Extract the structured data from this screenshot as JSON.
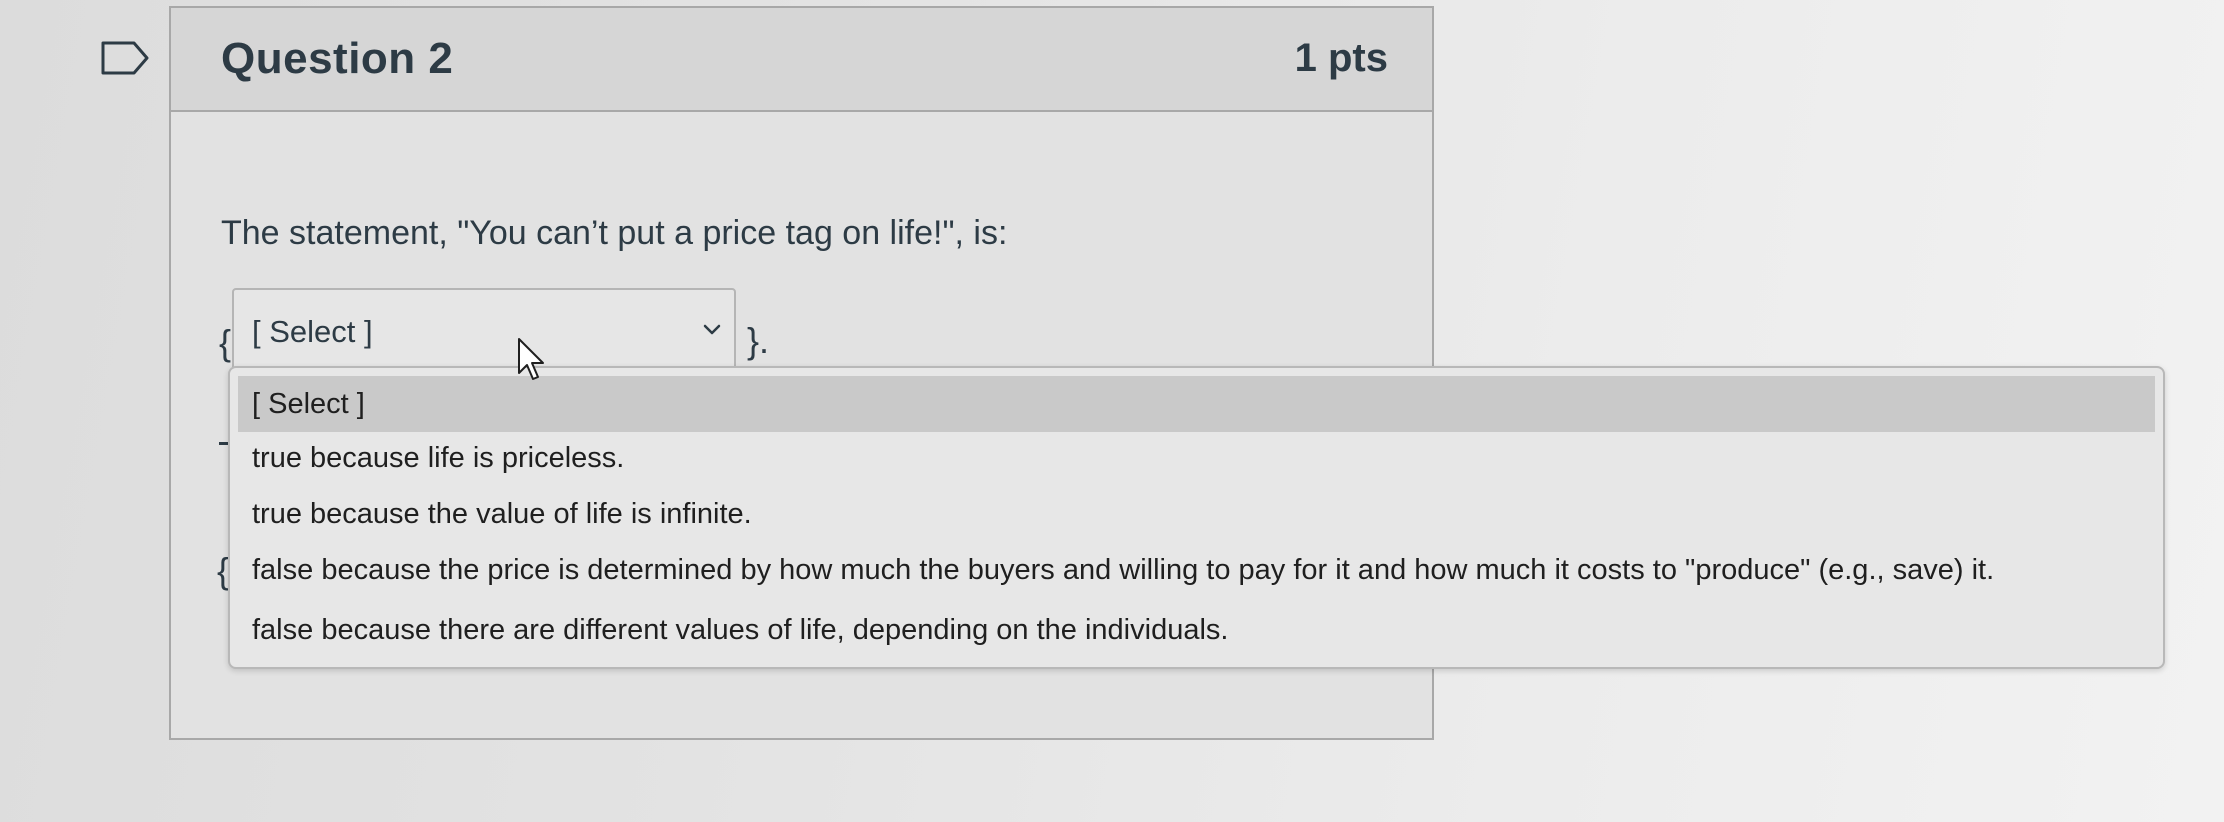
{
  "question": {
    "title": "Question 2",
    "points": "1 pts",
    "text": "The statement, \"You can’t put a price tag on life!\", is:"
  },
  "select": {
    "value": "[ Select ]",
    "brace_open": "{",
    "brace_close": "}."
  },
  "dropdown": {
    "options": [
      "[ Select ]",
      "true because life is priceless.",
      "true because the value of life is infinite.",
      "false because the price is determined by how much the buyers and willing to pay for it and how much it costs to \"produce\" (e.g., save) it.",
      "false because there are different values of life, depending on the individuals."
    ],
    "highlighted_index": 0
  },
  "colors": {
    "text": "#2d3b45",
    "header_bg": "#d6d6d6",
    "highlight_bg": "#c9c9c9"
  },
  "icons": {
    "flag": "flag-icon",
    "chevron": "chevron-down-icon",
    "cursor": "cursor-icon"
  }
}
